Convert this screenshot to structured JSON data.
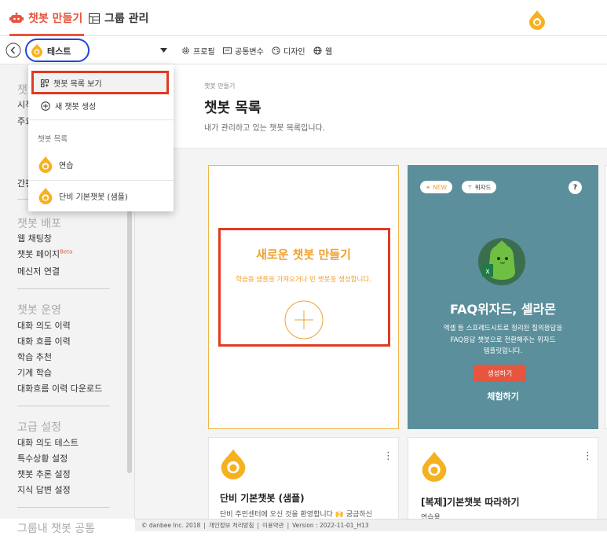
{
  "nav": {
    "tab_chatbot": "챗봇 만들기",
    "tab_group": "그룹 관리"
  },
  "toolbar": {
    "selected_bot": "테스트",
    "profile": "프로필",
    "common_vars": "공통변수",
    "design": "디자인",
    "web": "웹"
  },
  "dropdown": {
    "view_list": "챗봇 목록 보기",
    "create_new": "새 챗봇 생성",
    "list_label": "챗봇 목록",
    "items": [
      "연습",
      "단비 기본챗봇 (샘플)"
    ]
  },
  "sidebar": {
    "partial1": "챗",
    "partial2": "시작",
    "partial3": "주요",
    "partial4": "간편",
    "section_deploy": "챗봇 배포",
    "deploy_items": [
      "웹 채팅창",
      "챗봇 페이지",
      "메신저 연결"
    ],
    "beta": "Beta",
    "section_ops": "챗봇 운영",
    "ops_items": [
      "대화 의도 이력",
      "대화 흐름 이력",
      "학습 추천",
      "기계 학습",
      "대화흐름 이력 다운로드"
    ],
    "section_adv": "고급 설정",
    "adv_items": [
      "대화 의도 테스트",
      "특수상황 설정",
      "챗봇 추론 설정",
      "지식 답변 설정"
    ],
    "section_group": "그룹내 챗봇 공통"
  },
  "main": {
    "breadcrumb": "챗봇 만들기",
    "title": "챗봇 목록",
    "subtitle": "내가 관리하고 있는 챗봇 목록입니다."
  },
  "new_card": {
    "title": "새로운 챗봇 만들기",
    "desc": "학습용 샘플을 가져오거나 빈 챗봇을 생성합니다."
  },
  "faq_card": {
    "badge_new": "NEW",
    "badge_wizard": "위자드",
    "help": "?",
    "title": "FAQ위자드, 셀라몬",
    "desc1": "엑셀 등 스프레드시트로 정리된 질의응답을",
    "desc2": "FAQ응답 챗봇으로 전환해주는 위자드",
    "desc3": "템플릿입니다.",
    "create_button": "생성하기",
    "try_button": "체험하기",
    "bg_color": "#5a8f9b",
    "button_color": "#e8553e"
  },
  "bot_cards": [
    {
      "title": "단비 기본챗봇 (샘플)",
      "desc": "단비 주민센터에 오신 것을 환영합니다 🙌 궁금하신"
    },
    {
      "title": "[복제]기본챗봇 따라하기",
      "desc": "연습용"
    }
  ],
  "footer": {
    "copyright": "© danbee Inc. 2018",
    "privacy": "개인정보 처리방침",
    "terms": "이용약관",
    "version": "Version : 2022-11-01_H13"
  },
  "colors": {
    "accent": "#e8553e",
    "brand_yellow": "#f5b120",
    "orange_text": "#f0a030"
  }
}
